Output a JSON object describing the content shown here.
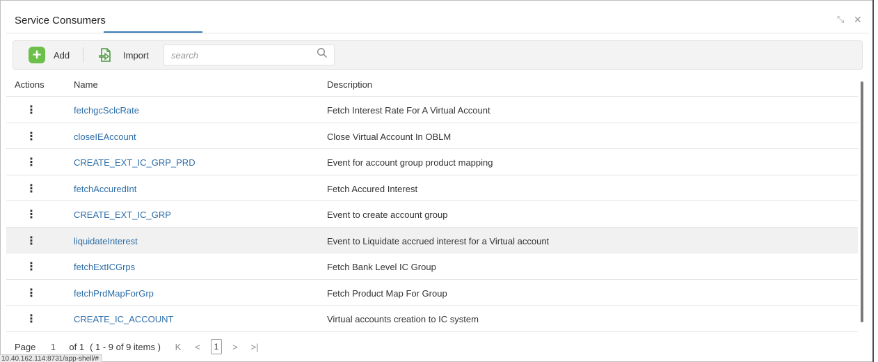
{
  "window": {
    "title": "Service Consumers",
    "minimize_glyph": "⤡",
    "close_glyph": "✕"
  },
  "toolbar": {
    "add_label": "Add",
    "import_label": "Import",
    "search_placeholder": "search",
    "add_icon": "plus-icon",
    "import_icon": "import-icon",
    "search_icon": "search-icon"
  },
  "table": {
    "columns": [
      "Actions",
      "Name",
      "Description"
    ],
    "rows": [
      {
        "actions": "⋮",
        "name": "fetchgcSclcRate",
        "description": "Fetch Interest Rate For A Virtual Account"
      },
      {
        "actions": "⋮",
        "name": "closeIEAccount",
        "description": "Close Virtual Account In OBLM"
      },
      {
        "actions": "⋮",
        "name": "CREATE_EXT_IC_GRP_PRD",
        "description": "Event for account group product mapping"
      },
      {
        "actions": "⋮",
        "name": "fetchAccuredInt",
        "description": "Fetch Accured Interest"
      },
      {
        "actions": "⋮",
        "name": "CREATE_EXT_IC_GRP",
        "description": "Event to create account group"
      },
      {
        "actions": "⋮",
        "name": "liquidateInterest",
        "description": "Event to Liquidate accrued interest for a Virtual account"
      },
      {
        "actions": "⋮",
        "name": "fetchExtICGrps",
        "description": "Fetch Bank Level IC Group"
      },
      {
        "actions": "⋮",
        "name": "fetchPrdMapForGrp",
        "description": "Fetch Product Map For Group"
      },
      {
        "actions": "⋮",
        "name": "CREATE_IC_ACCOUNT",
        "description": "Virtual accounts creation to IC system"
      }
    ]
  },
  "pager": {
    "page_label": "Page",
    "page_value": "1",
    "of_text": "of 1",
    "items_text": "( 1 - 9 of 9 items )",
    "first_glyph": "K",
    "prev_glyph": "<",
    "current_page": "1",
    "next_glyph": ">",
    "last_glyph": ">|"
  },
  "status_bar": {
    "url": "10.40.162.114:8731/app-shell/#"
  },
  "colors": {
    "accent": "#3e7cb6",
    "link": "#2d6ea8",
    "add_green": "#6cc04a",
    "row_highlight": "#f1f1f1"
  }
}
